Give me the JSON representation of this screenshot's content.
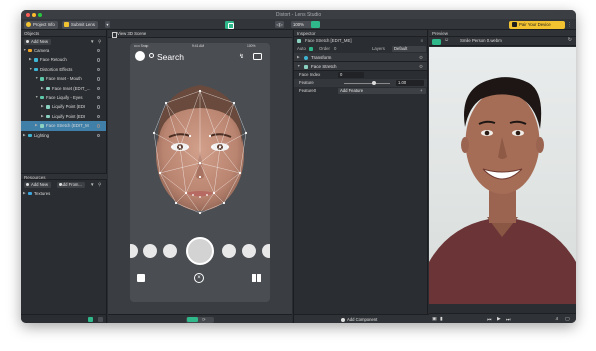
{
  "window": {
    "title": "Distort - Lens Studio"
  },
  "toolbar": {
    "project_info": "Project Info",
    "submit_lens": "Submit Lens",
    "zoom": "100%",
    "pair_device": "Pair Your Device",
    "colors": {
      "accent_green": "#2fb98a",
      "pair_yellow": "#f2c230"
    }
  },
  "objects": {
    "title": "Objects",
    "add_new": "Add New",
    "items": [
      {
        "label": "Camera",
        "depth": 0,
        "expanded": true,
        "icon": "camera-icon",
        "color": "#f0a526",
        "selected": false
      },
      {
        "label": "Face Retouch",
        "depth": 1,
        "expanded": false,
        "icon": "face-icon",
        "color": "#3fb6d3",
        "selected": false
      },
      {
        "label": "Distortion Effects",
        "depth": 1,
        "expanded": true,
        "icon": "layers-icon",
        "color": "#3fb6d3",
        "selected": false
      },
      {
        "label": "Face Inset - Mouth",
        "depth": 2,
        "expanded": true,
        "icon": "face-icon",
        "color": "#5ec9a8",
        "selected": false
      },
      {
        "label": "Face Inset (EDIT_...",
        "depth": 3,
        "expanded": false,
        "icon": "component-icon",
        "color": "#8ad1c2",
        "selected": false
      },
      {
        "label": "Face Liquify - Eyes",
        "depth": 2,
        "expanded": true,
        "icon": "face-icon",
        "color": "#5ec9a8",
        "selected": false
      },
      {
        "label": "Liquify Point (EDI",
        "depth": 3,
        "expanded": false,
        "icon": "component-icon",
        "color": "#8ad1c2",
        "selected": false
      },
      {
        "label": "Liquify Point (EDI",
        "depth": 3,
        "expanded": false,
        "icon": "component-icon",
        "color": "#8ad1c2",
        "selected": false
      },
      {
        "label": "Face Stretch (EDIT_M",
        "depth": 2,
        "expanded": false,
        "icon": "component-icon",
        "color": "#8ad1c2",
        "selected": true
      },
      {
        "label": "Lighting",
        "depth": 0,
        "expanded": false,
        "icon": "light-icon",
        "color": "#3fb6d3",
        "selected": false
      }
    ]
  },
  "resources": {
    "title": "Resources",
    "add_new": "Add New",
    "add_from": "Add From...",
    "items": [
      {
        "label": "Textures",
        "icon": "folder-icon",
        "color": "#3fa7e0"
      }
    ]
  },
  "scene": {
    "view_3d": "View 3D Scene",
    "phone": {
      "carrier": "••••• Snap",
      "time": "9:41 AM",
      "battery": "100%",
      "search": "Search"
    }
  },
  "inspector": {
    "title": "Inspector",
    "object_name": "Face Stretch [EDIT_ME]",
    "auto_label": "Auto",
    "order_label": "Order",
    "order_value": "0",
    "layers_label": "Layers",
    "layers_value": "Default",
    "transform_label": "Transform",
    "face_stretch_label": "Face Stretch",
    "face_index_label": "Face Index",
    "face_index_value": "0",
    "feature_label": "Feature",
    "feature_value": "1.00",
    "feature_fraction": 0.65,
    "feature0_label": "Feature0",
    "add_feature": "Add Feature",
    "add_component": "Add Component"
  },
  "preview": {
    "title": "Preview",
    "source": "Smile Person 0.webm"
  }
}
